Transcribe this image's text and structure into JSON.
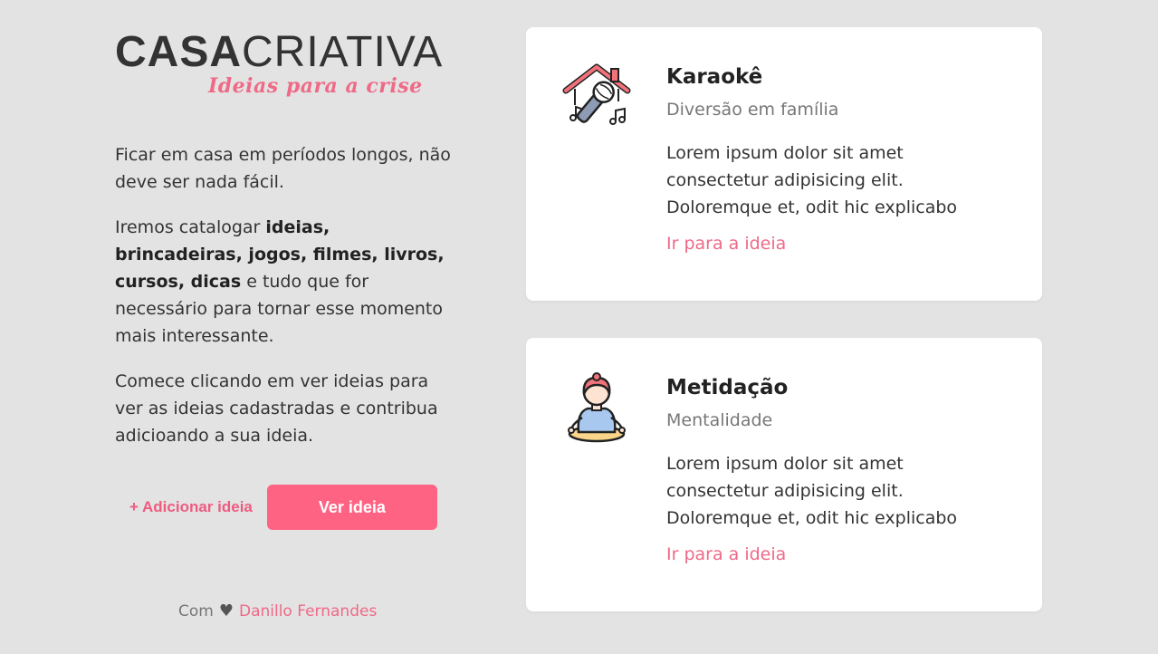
{
  "brand": {
    "name_bold": "CASA",
    "name_light": "CRIATIVA",
    "tagline": "Ideias para a crise"
  },
  "intro": {
    "p1": "Ficar em casa em períodos longos, não deve ser nada fácil.",
    "p2_before": "Iremos catalogar ",
    "p2_bold": "ideias, brincadeiras, jogos, filmes, livros, cursos, dicas",
    "p2_after": " e tudo que for necessário para tornar esse momento mais interessante.",
    "p3": "Comece clicando em ver ideias para ver as ideias cadastradas e contribua adicioando a sua ideia."
  },
  "actions": {
    "add_label": "+ Adicionar ideia",
    "view_label": "Ver ideia"
  },
  "footer": {
    "prefix": "Com",
    "author": "Danillo Fernandes"
  },
  "cards": [
    {
      "icon": "karaoke-house-microphone-icon",
      "title": "Karaokê",
      "category": "Diversão em família",
      "description": "Lorem ipsum dolor sit amet consectetur adipisicing elit. Doloremque et, odit hic explicabo",
      "link": "Ir para a ideia"
    },
    {
      "icon": "meditation-person-icon",
      "title": "Metidação",
      "category": "Mentalidade",
      "description": "Lorem ipsum dolor sit amet consectetur adipisicing elit. Doloremque et, odit hic explicabo",
      "link": "Ir para a ideia"
    }
  ],
  "colors": {
    "background": "#e3e3e3",
    "accent": "#ff6384",
    "link": "#ee6a87"
  }
}
